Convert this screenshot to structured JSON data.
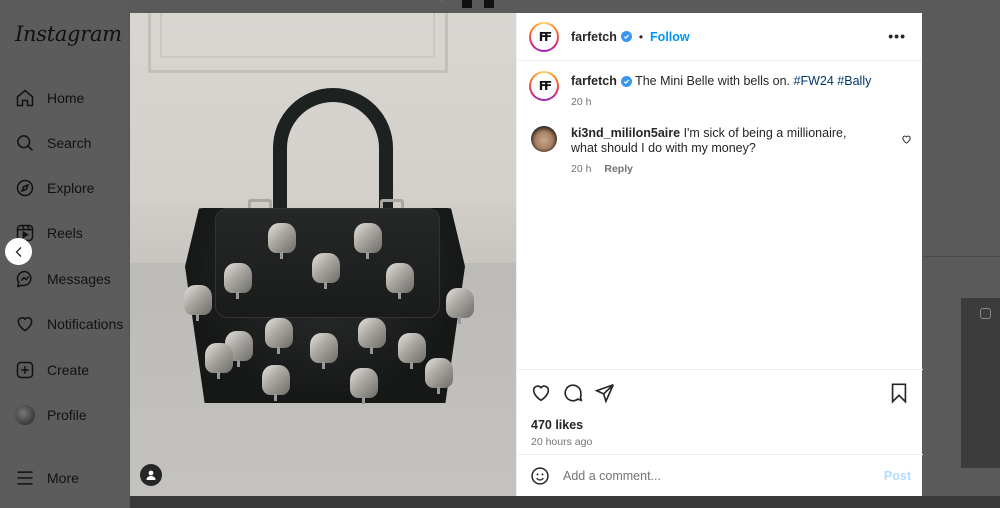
{
  "sidebar": {
    "logo": "Instagram",
    "items": [
      {
        "label": "Home",
        "icon": "home-icon"
      },
      {
        "label": "Search",
        "icon": "search-icon"
      },
      {
        "label": "Explore",
        "icon": "compass-icon"
      },
      {
        "label": "Reels",
        "icon": "reels-icon"
      },
      {
        "label": "Messages",
        "icon": "messenger-icon"
      },
      {
        "label": "Notifications",
        "icon": "heart-icon"
      },
      {
        "label": "Create",
        "icon": "plus-square-icon"
      },
      {
        "label": "Profile",
        "icon": "profile-avatar"
      },
      {
        "label": "More",
        "icon": "hamburger-icon"
      }
    ]
  },
  "post": {
    "author": {
      "username": "farfetch",
      "avatar_text": "FF",
      "verified": true,
      "separator": "•",
      "follow_label": "Follow"
    },
    "more_label": "•••",
    "caption": {
      "username": "farfetch",
      "text": "The Mini Belle with bells on.",
      "hashtags": [
        "#FW24",
        "#Bally"
      ],
      "time": "20 h"
    },
    "comments": [
      {
        "username": "ki3nd_mililon5aire",
        "text": "I'm sick of being a millionaire, what should I do with my money?",
        "time": "20 h",
        "reply_label": "Reply"
      }
    ],
    "likes": "470 likes",
    "posted_ago": "20 hours ago",
    "comment_input": {
      "placeholder": "Add a comment...",
      "value": "",
      "post_label": "Post"
    },
    "image_alt": "Black leather Bally Mini Belle handbag covered with metal bells"
  },
  "colors": {
    "accent": "#0095f6",
    "post_disabled": "#b3dbff",
    "hashtag": "#00376b",
    "verified": "#3897f0"
  }
}
